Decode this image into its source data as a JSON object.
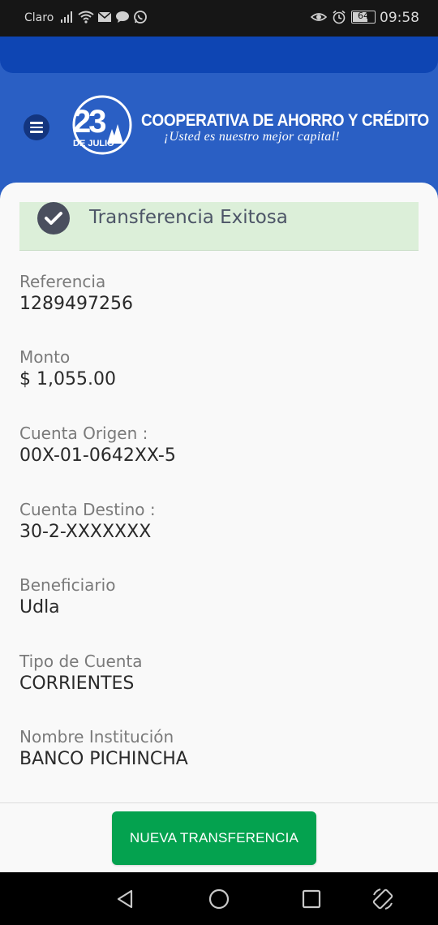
{
  "status_bar": {
    "carrier": "Claro",
    "battery_level": "64",
    "time": "09:58",
    "icons_left": [
      "signal-icon",
      "wifi-icon",
      "mail-icon",
      "chat-icon",
      "whatsapp-icon"
    ],
    "icons_right": [
      "eye-icon",
      "alarm-icon",
      "battery-icon"
    ]
  },
  "header": {
    "logo_number": "23",
    "logo_subtitle": "DE JULIO",
    "brand_name": "COOPERATIVA DE AHORRO Y CRÉDITO",
    "tagline": "¡Usted es nuestro mejor capital!"
  },
  "banner": {
    "message": "Transferencia Exitosa"
  },
  "fields": [
    {
      "label": "Referencia",
      "value": "1289497256"
    },
    {
      "label": "Monto",
      "value": "$ 1,055.00"
    },
    {
      "label": "Cuenta Origen :",
      "value": "00X-01-0642XX-5"
    },
    {
      "label": "Cuenta Destino :",
      "value": "30-2-XXXXXXX"
    },
    {
      "label": "Beneficiario",
      "value": "Udla"
    },
    {
      "label": "Tipo de Cuenta",
      "value": "CORRIENTES"
    },
    {
      "label": "Nombre Institución",
      "value": "BANCO PICHINCHA"
    }
  ],
  "actions": {
    "new_transfer": "NUEVA TRANSFERENCIA"
  },
  "colors": {
    "header_blue": "#2a5fc4",
    "header_strip": "#0e45b3",
    "success_bg": "#dcefd9",
    "button_green": "#04a24f"
  }
}
